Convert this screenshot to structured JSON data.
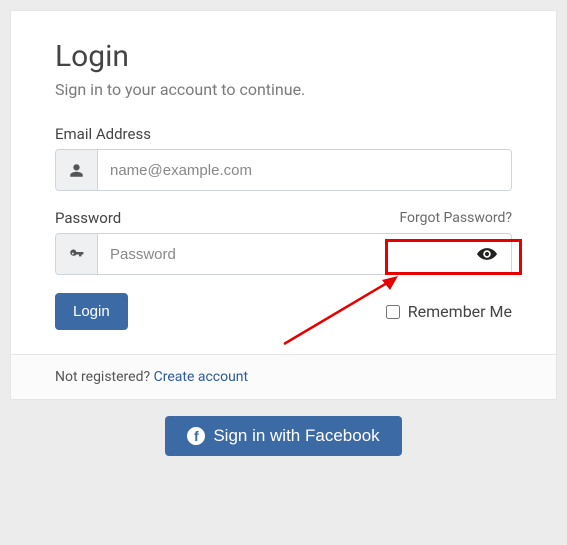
{
  "title": "Login",
  "subtitle": "Sign in to your account to continue.",
  "email": {
    "label": "Email Address",
    "placeholder": "name@example.com"
  },
  "password": {
    "label": "Password",
    "placeholder": "Password",
    "forgot": "Forgot Password?"
  },
  "login_button": "Login",
  "remember_label": "Remember Me",
  "footer": {
    "prefix": "Not registered? ",
    "link": "Create account"
  },
  "facebook_button": "Sign in with Facebook"
}
